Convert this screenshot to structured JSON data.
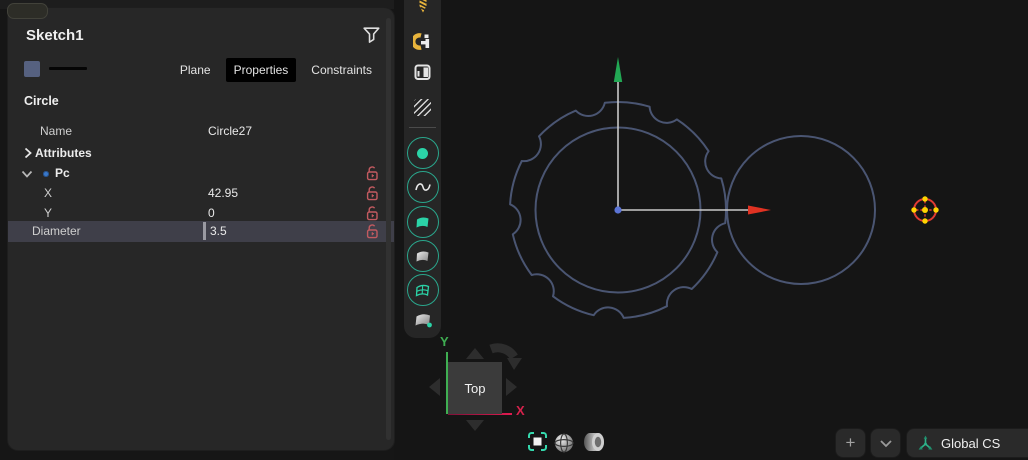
{
  "panel": {
    "title": "Sketch1",
    "tabs": [
      {
        "label": "Plane",
        "active": false
      },
      {
        "label": "Properties",
        "active": true
      },
      {
        "label": "Constraints",
        "active": false
      }
    ],
    "section_title": "Circle",
    "fields": {
      "name": {
        "label": "Name",
        "value": "Circle27"
      },
      "attributes": {
        "label": "Attributes"
      },
      "point_group": {
        "label": "Pc"
      },
      "x": {
        "label": "X",
        "value": "42.95",
        "locked": false
      },
      "y": {
        "label": "Y",
        "value": "0",
        "locked": false
      },
      "diameter": {
        "label": "Diameter",
        "value": "3.5",
        "locked": false,
        "editing": true
      }
    }
  },
  "toolbar": {
    "icons": [
      "drill-tool",
      "mill-tool",
      "sketch-sheet",
      "hatch-pattern",
      "circle-point-tool",
      "spline-tool",
      "surface-fill-tool",
      "surface-tool",
      "surface-grid-tool",
      "surface-point-tool"
    ]
  },
  "viewcube": {
    "face_label": "Top",
    "y_axis_label": "Y",
    "x_axis_label": "X"
  },
  "statusbar": {
    "cs_button_label": "Global CS",
    "buttons": [
      "add-view",
      "expand-views",
      "coordinate-system"
    ]
  },
  "colors": {
    "accent_teal": "#2aa68c",
    "glyph_teal": "#2bd3a7",
    "lock_red": "#c25a60",
    "sketch_line": "#4a5572",
    "axis_green": "#22a854",
    "axis_red": "#e03222",
    "origin_blue": "#5b74d6",
    "selection_red": "#e23b33",
    "handle_yellow": "#ffd400",
    "viewcube_y_green": "#3fae52",
    "viewcube_x_red": "#d6224c"
  }
}
